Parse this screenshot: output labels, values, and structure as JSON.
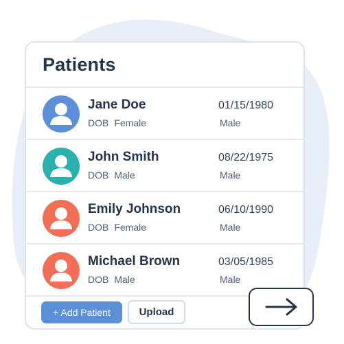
{
  "page": {
    "title": "Patients"
  },
  "patients": [
    {
      "name": "Jane Doe",
      "dob_label": "DOB",
      "gender": "Female",
      "date": "01/15/1980",
      "sex": "Male",
      "avatar_color": "#5b8fd8"
    },
    {
      "name": "John Smith",
      "dob_label": "DOB",
      "gender": "Male",
      "date": "08/22/1975",
      "sex": "Male",
      "avatar_color": "#2bb0ad"
    },
    {
      "name": "Emily Johnson",
      "dob_label": "DOB",
      "gender": "Female",
      "date": "06/10/1990",
      "sex": "Male",
      "avatar_color": "#f26e57"
    },
    {
      "name": "Michael Brown",
      "dob_label": "DOB",
      "gender": "Male",
      "date": "03/05/1985",
      "sex": "Male",
      "avatar_color": "#f26e57"
    }
  ],
  "actions": {
    "add_label": "+ Add Patient",
    "upload_label": "Upload",
    "next_icon": "arrow-right-icon"
  },
  "colors": {
    "accent": "#5b8fd8",
    "text": "#263449",
    "border": "#dbe3ee",
    "backdrop": "#e7eef7"
  }
}
